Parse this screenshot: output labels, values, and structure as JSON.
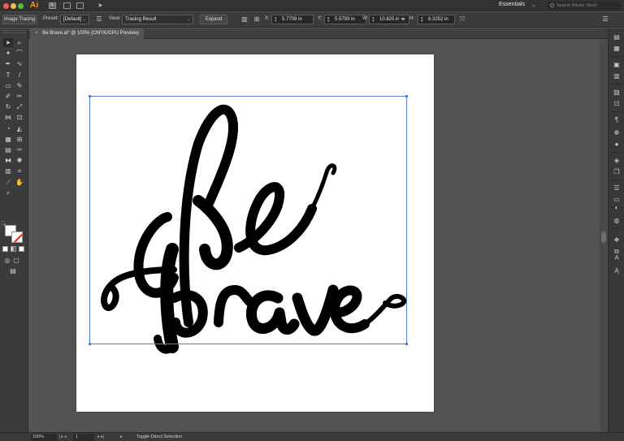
{
  "app": {
    "name": "Ai",
    "workspace": "Essentials",
    "stock_search_placeholder": "Search Adobe Stock",
    "bridge_label": "Br"
  },
  "controlbar": {
    "image_tracing_label": "Image Tracing",
    "preset_label": "Preset:",
    "preset_value": "[Default]",
    "view_label": "View:",
    "view_value": "Tracing Result",
    "expand_label": "Expand",
    "x_label": "X:",
    "x_value": "5.7708 in",
    "y_label": "Y:",
    "y_value": "5.5793 in",
    "w_label": "W:",
    "w_value": "10.825 in",
    "h_label": "H:",
    "h_value": "8.3252 in"
  },
  "document": {
    "tab_title": "Be Brave.ai* @ 100% (CMYK/GPU Preview)",
    "close_glyph": "×"
  },
  "statusbar": {
    "zoom": "100%",
    "page": "1",
    "tool_hint": "Toggle Direct Selection"
  },
  "colors": {
    "accent_selection": "#4f7fd6",
    "fill": "#ffffff",
    "stroke_none": "#e0261f",
    "artwork": "#000000"
  },
  "tools": [
    "selection-tool-icon",
    "direct-selection-tool-icon",
    "magic-wand-tool-icon",
    "lasso-tool-icon",
    "pen-tool-icon",
    "curvature-tool-icon",
    "type-tool-icon",
    "line-segment-tool-icon",
    "rectangle-tool-icon",
    "paintbrush-tool-icon",
    "shaper-tool-icon",
    "scissors-tool-icon",
    "rotate-tool-icon",
    "scale-tool-icon",
    "width-tool-icon",
    "free-transform-tool-icon",
    "shape-builder-tool-icon",
    "live-paint-tool-icon",
    "perspective-grid-tool-icon",
    "mesh-tool-icon",
    "gradient-tool-icon",
    "eyedropper-tool-icon",
    "blend-tool-icon",
    "symbol-sprayer-tool-icon",
    "column-graph-tool-icon",
    "artboard-tool-icon",
    "slice-tool-icon",
    "hand-tool-icon",
    "zoom-tool-icon"
  ]
}
